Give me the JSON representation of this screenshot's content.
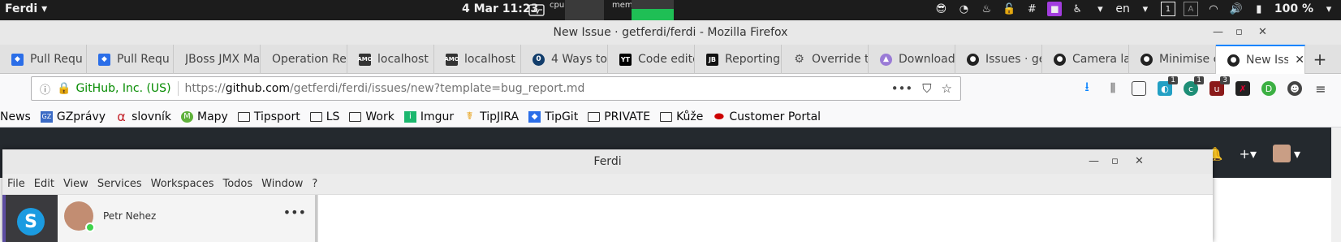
{
  "topbar": {
    "app_name": "Ferdi ▾",
    "clock": "4 Mar  11:23",
    "cpu_label": "cpu",
    "mem_label": "mem",
    "language": "en",
    "battery": "100 %"
  },
  "firefox": {
    "title": "New Issue · getferdi/ferdi - Mozilla Firefox",
    "tabs": [
      {
        "label": "Pull Requ",
        "color": "#2b6ee8"
      },
      {
        "label": "Pull Requ",
        "color": "#2b6ee8"
      },
      {
        "label": "JBoss JMX Ma",
        "color": ""
      },
      {
        "label": "Operation Re",
        "color": ""
      },
      {
        "label": "localhost",
        "color": "#444"
      },
      {
        "label": "localhost",
        "color": "#444"
      },
      {
        "label": "4 Ways to",
        "color": "#123d6b"
      },
      {
        "label": "Code edito",
        "color": "#000"
      },
      {
        "label": "Reporting",
        "color": "#222"
      },
      {
        "label": "Override t",
        "color": "#555"
      },
      {
        "label": "Download",
        "color": "#9a7bd6"
      },
      {
        "label": "Issues · ge",
        "color": "#222"
      },
      {
        "label": "Camera la",
        "color": "#222"
      },
      {
        "label": "Minimise c",
        "color": "#222"
      },
      {
        "label": "New Iss",
        "color": "#222"
      }
    ],
    "url": {
      "org": "GitHub, Inc. (US)",
      "prefix": "https://",
      "host": "github.com",
      "path": "/getferdi/ferdi/issues/new?template=bug_report.md"
    },
    "extension_badges": [
      "1",
      "1",
      "3"
    ],
    "bookmarks": [
      {
        "label": "News",
        "icon": ""
      },
      {
        "label": "GZprávy",
        "icon": "gz"
      },
      {
        "label": "slovník",
        "icon": "alpha"
      },
      {
        "label": "Mapy",
        "icon": "m"
      },
      {
        "label": "Tipsport",
        "icon": "folder"
      },
      {
        "label": "LS",
        "icon": "folder"
      },
      {
        "label": "Work",
        "icon": "folder"
      },
      {
        "label": "Imgur",
        "icon": "imgur"
      },
      {
        "label": "TipJIRA",
        "icon": "jira"
      },
      {
        "label": "TipGit",
        "icon": "git"
      },
      {
        "label": "PRIVATE",
        "icon": "folder"
      },
      {
        "label": "Kůže",
        "icon": "folder"
      },
      {
        "label": "Customer Portal",
        "icon": "redhat"
      }
    ]
  },
  "ferdi": {
    "title": "Ferdi",
    "menu": [
      "File",
      "Edit",
      "View",
      "Services",
      "Workspaces",
      "Todos",
      "Window",
      "?"
    ],
    "contact_name": "Petr Nehez"
  }
}
